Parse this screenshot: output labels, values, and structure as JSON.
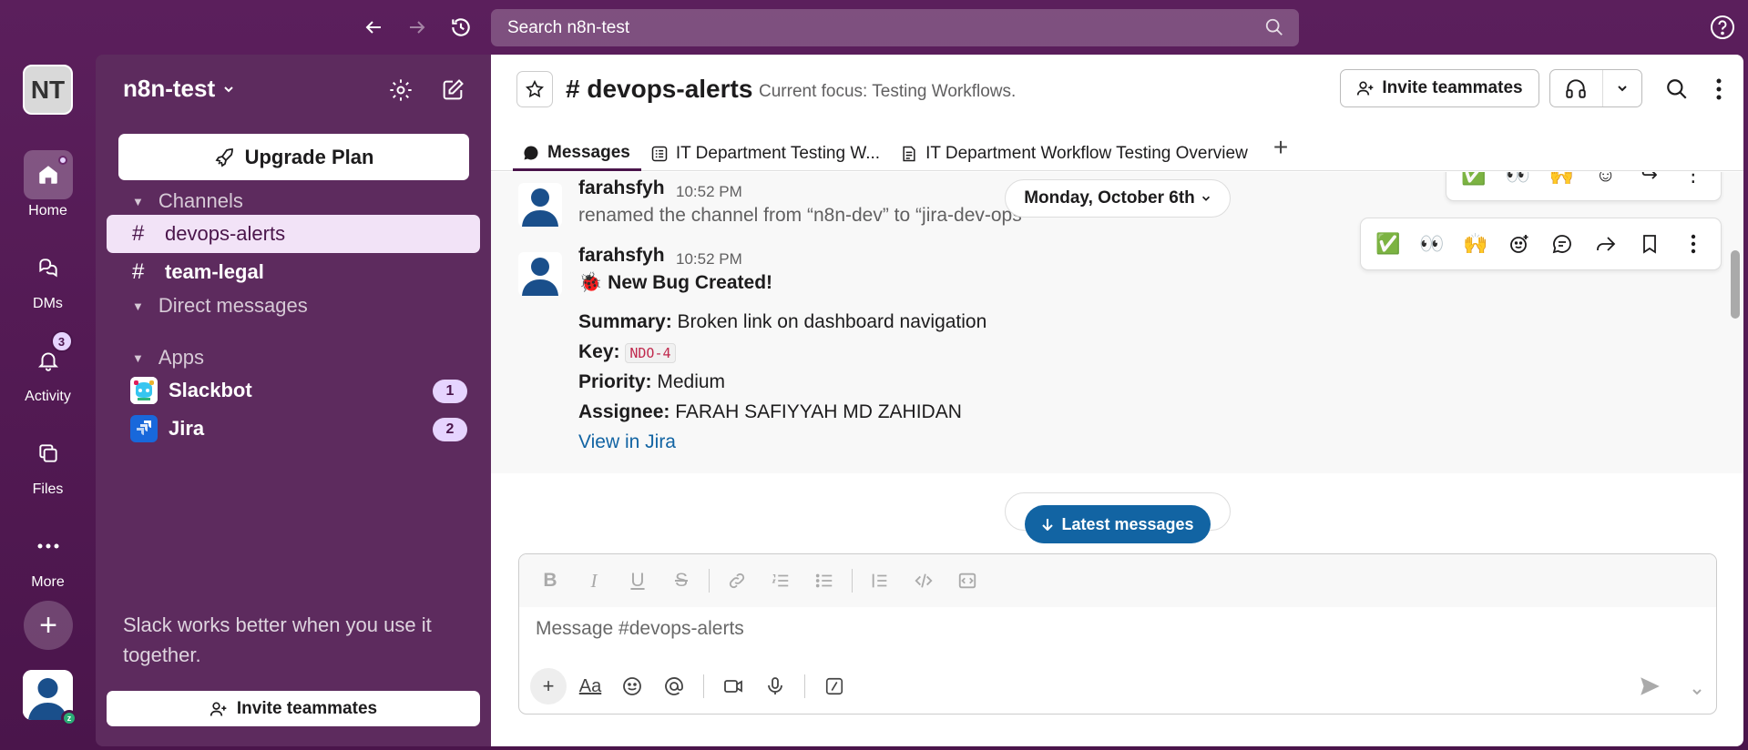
{
  "search": {
    "placeholder": "Search n8n-test"
  },
  "workspace": {
    "initials": "NT",
    "name": "n8n-test"
  },
  "rail": {
    "items": [
      {
        "label": "Home"
      },
      {
        "label": "DMs"
      },
      {
        "label": "Activity",
        "badge": "3"
      },
      {
        "label": "Files"
      },
      {
        "label": "More"
      }
    ]
  },
  "sidebar": {
    "upgrade_label": "Upgrade Plan",
    "channels_header": "Channels",
    "channels": [
      {
        "name": "devops-alerts"
      },
      {
        "name": "team-legal"
      }
    ],
    "dm_header": "Direct messages",
    "apps_header": "Apps",
    "apps": [
      {
        "name": "Slackbot",
        "count": "1"
      },
      {
        "name": "Jira",
        "count": "2"
      }
    ],
    "hint": "Slack works better when you use it together.",
    "invite_label": "Invite teammates"
  },
  "channel": {
    "title": "# devops-alerts",
    "topic": "Current focus: Testing Workflows.",
    "invite_label": "Invite teammates",
    "tabs": [
      {
        "label": "Messages"
      },
      {
        "label": "IT Department Testing W..."
      },
      {
        "label": "IT Department Workflow Testing Overview"
      }
    ]
  },
  "messages": {
    "date_divider": "Monday, October 6th",
    "m1": {
      "author": "farahsfyh",
      "time": "10:52 PM",
      "text": "renamed the channel from “n8n-dev” to “jira-dev-ops"
    },
    "m2": {
      "author": "farahsfyh",
      "time": "10:52 PM",
      "title": "New Bug Created!",
      "summary_label": "Summary:",
      "summary": "Broken link on dashboard navigation",
      "key_label": "Key:",
      "key": "NDO-4",
      "priority_label": "Priority:",
      "priority": "Medium",
      "assignee_label": "Assignee:",
      "assignee": "FARAH SAFIYYAH MD ZAHIDAN",
      "link": "View in Jira"
    },
    "latest_label": "Latest messages"
  },
  "composer": {
    "placeholder": "Message #devops-alerts"
  },
  "colors": {
    "aubergine": "#4a154b",
    "link": "#1264a3",
    "badge": "#e6d4ff"
  }
}
